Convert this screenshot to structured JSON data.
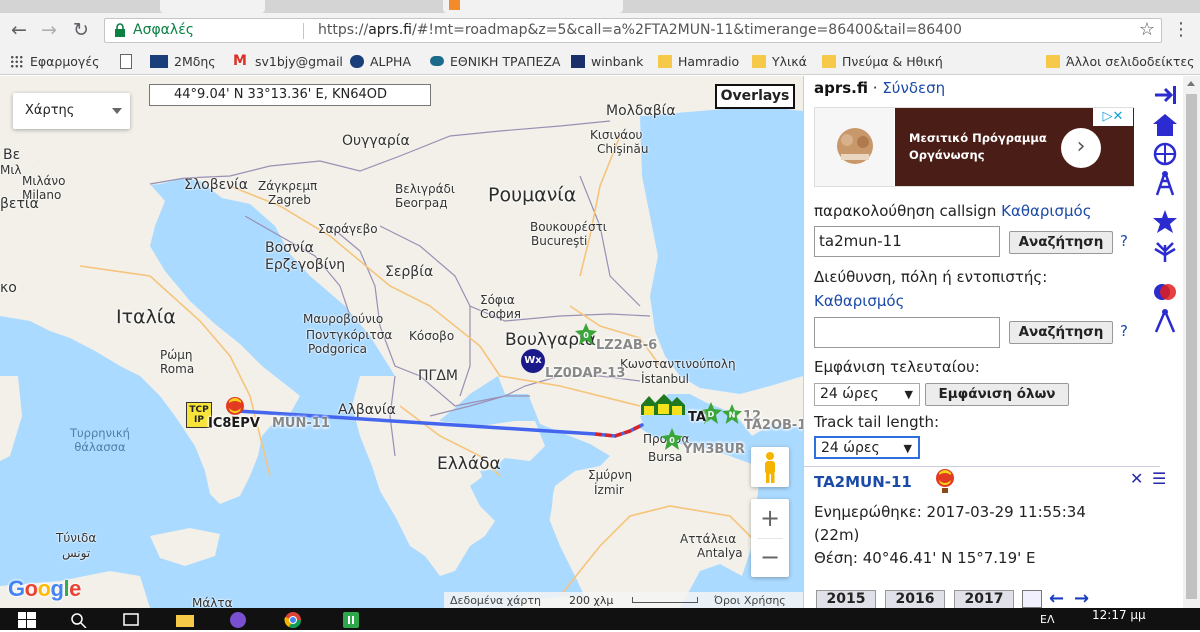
{
  "browser": {
    "secure_label": "Ασφαλές",
    "url_prefix": "https://",
    "url_host": "aprs.fi",
    "url_rest": "/#!mt=roadmap&z=5&call=a%2FTA2MUN-11&timerange=86400&tail=86400",
    "bookmarks": [
      {
        "label": "Εφαρμογές",
        "icon": "apps-grid-icon"
      },
      {
        "label": "",
        "icon": "document-icon"
      },
      {
        "label": "2Μδης",
        "icon": "site-favicon"
      },
      {
        "label": "sv1bjy@gmail",
        "icon": "gmail-icon"
      },
      {
        "label": "ALPHA",
        "icon": "site-favicon"
      },
      {
        "label": "ΕΘΝΙΚΗ ΤΡΑΠΕΖΑ",
        "icon": "site-favicon"
      },
      {
        "label": "winbank",
        "icon": "site-favicon"
      },
      {
        "label": "Hamradio",
        "icon": "folder-icon"
      },
      {
        "label": "Υλικά",
        "icon": "folder-icon"
      },
      {
        "label": "Πνεύμα & Ηθική",
        "icon": "folder-icon"
      },
      {
        "label": "Άλλοι σελιδοδείκτες",
        "icon": "folder-icon"
      }
    ]
  },
  "map": {
    "type_selector": "Χάρτης",
    "coordinates": "44°9.04' N 33°13.36' E, KN64OD",
    "overlays_label": "Overlays",
    "google_logo": "Google",
    "footer": {
      "data": "Δεδομένα χάρτη",
      "scale": "200 χλμ",
      "terms": "Όροι Χρήσης"
    },
    "countries": {
      "romania": "Ρουμανία",
      "italy": "Ιταλία",
      "bulgaria": "Βουλγαρία",
      "greece": "Ελλάδα",
      "serbia": "Σερβία",
      "albania": "Αλβανία",
      "moldova": "Μολδαβία",
      "hungary": "Ουγγαρία",
      "bosnia": "Βοσνία\nΕρζεγοβίνη",
      "montenegro": "Μαυροβούνιο",
      "kosovo": "Κόσοβο",
      "fyrom": "ΠΓΔΜ",
      "slovenia": "Σλοβενία"
    },
    "cities": {
      "rome": "Ρώμη",
      "roma": "Roma",
      "milan": "Μιλάνο",
      "milano": "Milano",
      "zagreb": "Ζάγκρεμπ",
      "zagreb_lat": "Zagreb",
      "belgrade": "Βελιγράδι",
      "beograd": "Београд",
      "sarajevo": "Σαράγεβο",
      "podgorica_el": "Ποντγκόριτσα",
      "podgorica": "Podgorica",
      "bucharest": "Βουκουρέστι",
      "bucuresti": "Bucureşti",
      "sofia": "Σόφια",
      "sofia_cyr": "София",
      "kishinev": "Κισινάου",
      "chisinau": "Chişinău",
      "istanbul_el": "Κωνσταντινούπολη",
      "istanbul": "İstanbul",
      "bursa": "Bursa",
      "prousa": "Προύσα",
      "smyrna": "Σμύρνη",
      "izmir": "İzmir",
      "antalya_el": "Αττάλεια",
      "antalya": "Antalya",
      "tunis_el": "Τύνιδα",
      "tunis": "تونس",
      "malta": "Μάλτα",
      "ve": "Βε",
      "milo_fragment": "Mιλ",
      "ko": "κο",
      "betia": "βετία"
    },
    "seas": {
      "tyrrhenian": "Τυρρηνική\nθάλασσα"
    },
    "stations": {
      "main": "TA2MUN-11",
      "main_shown": "MUN-11",
      "ic8epv": "IC8EPV",
      "lz2ab": "LZ2AB-6",
      "lz0dap": "LZ0DAP-13",
      "ta_left": "TA",
      "ta2ob": "TA2OB-1",
      "ym3bur": "YM3BUR",
      "n12": "12",
      "tcpip": "TCP\nIP",
      "wx": "Wx"
    }
  },
  "panel": {
    "brand": "aprs.fi",
    "login": "Σύνδεση",
    "ad": {
      "text": "Μεσιτικό Πρόγραμμα Οργάνωσης",
      "go": "›",
      "choices": "▷✕"
    },
    "track_label": "παρακολούθηση callsign",
    "track_clear": "Καθαρισμός",
    "track_value": "ta2mun-11",
    "search_button": "Αναζήτηση",
    "help": "?",
    "address_label": "Διεύθυνση, πόλη ή εντοπιστής:",
    "address_clear": "Καθαρισμός",
    "address_value": "",
    "show_last_label": "Εμφάνιση τελευταίου:",
    "show_last_value": "24 ώρες",
    "show_all_button": "Εμφάνιση όλων",
    "tail_label": "Track tail length:",
    "tail_value": "24 ώρες",
    "station": {
      "name": "TA2MUN-11",
      "updated": "Ενημερώθηκε: 2017-03-29 11:55:34",
      "ago": "(22m)",
      "position": "Θέση: 40°46.41' N 15°7.19' E"
    },
    "years": [
      "2015",
      "2016",
      "2017"
    ]
  },
  "taskbar": {
    "lang": "ΕΛ",
    "clock": "12:17 μμ"
  },
  "colors": {
    "track": "#4466ee",
    "track_recent": "#dd2222",
    "link": "#1b4aa8",
    "secure": "#0b8043"
  }
}
